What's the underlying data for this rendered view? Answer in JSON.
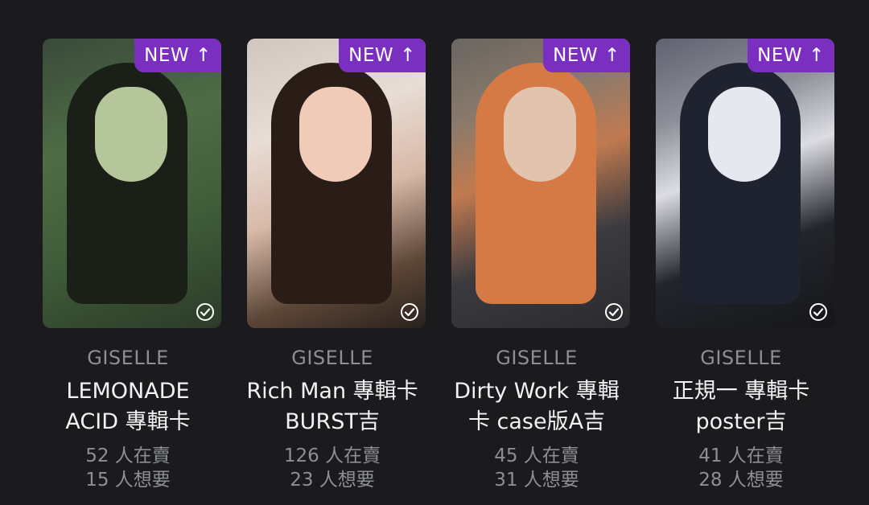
{
  "cards": [
    {
      "badge": "NEW",
      "badge_icon": "arrow-up-icon",
      "artist": "GISELLE",
      "title_line1": "LEMONADE",
      "title_line2": "ACID 專輯卡",
      "sellers": "52 人在賣",
      "wanters": "15 人想要"
    },
    {
      "badge": "NEW",
      "badge_icon": "arrow-up-icon",
      "artist": "GISELLE",
      "title_line1": "Rich Man 專輯卡",
      "title_line2": "BURST吉",
      "sellers": "126 人在賣",
      "wanters": "23 人想要"
    },
    {
      "badge": "NEW",
      "badge_icon": "arrow-up-icon",
      "artist": "GISELLE",
      "title_line1": "Dirty Work 專輯",
      "title_line2": "卡 case版A吉",
      "sellers": "45 人在賣",
      "wanters": "31 人想要"
    },
    {
      "badge": "NEW",
      "badge_icon": "arrow-up-icon",
      "artist": "GISELLE",
      "title_line1": "正規一 專輯卡",
      "title_line2": "poster吉",
      "sellers": "41 人在賣",
      "wanters": "28 人想要"
    }
  ],
  "colors": {
    "background": "#1b1b1d",
    "badge": "#7b2fc0",
    "muted_text": "#8c8f96",
    "primary_text": "#f2f2f4"
  }
}
